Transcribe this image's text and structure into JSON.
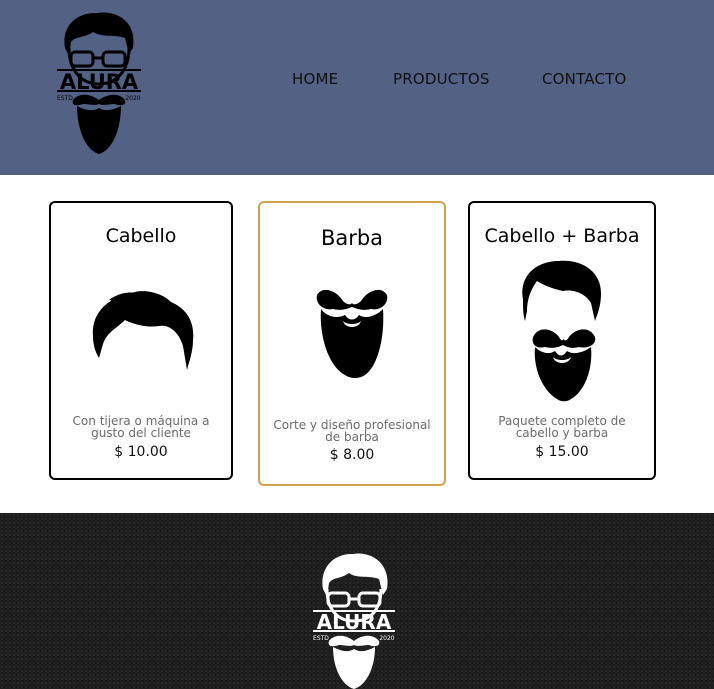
{
  "header": {
    "logo": {
      "brand": "ALURA",
      "left_text": "ESTD",
      "right_text": "2020",
      "icon": "bearded-man-logo-icon"
    },
    "nav": [
      {
        "label": "HOME"
      },
      {
        "label": "PRODUCTOS"
      },
      {
        "label": "CONTACTO"
      }
    ]
  },
  "products": [
    {
      "title": "Cabello",
      "description": "Con tijera o máquina a gusto del cliente",
      "price": "$ 10.00",
      "icon": "hair-icon"
    },
    {
      "title": "Barba",
      "description": "Corte y diseño profesional de barba",
      "price": "$ 8.00",
      "icon": "beard-icon"
    },
    {
      "title": "Cabello + Barba",
      "description": "Paquete completo de cabello y barba",
      "price": "$ 15.00",
      "icon": "hair-and-beard-icon"
    }
  ],
  "footer": {
    "logo": {
      "brand": "ALURA",
      "left_text": "ESTD",
      "right_text": "2020",
      "icon": "bearded-man-logo-icon"
    }
  },
  "colors": {
    "header_bg": "#536184",
    "featured_border": "#d0a250",
    "footer_bg": "#1e1e1e"
  }
}
